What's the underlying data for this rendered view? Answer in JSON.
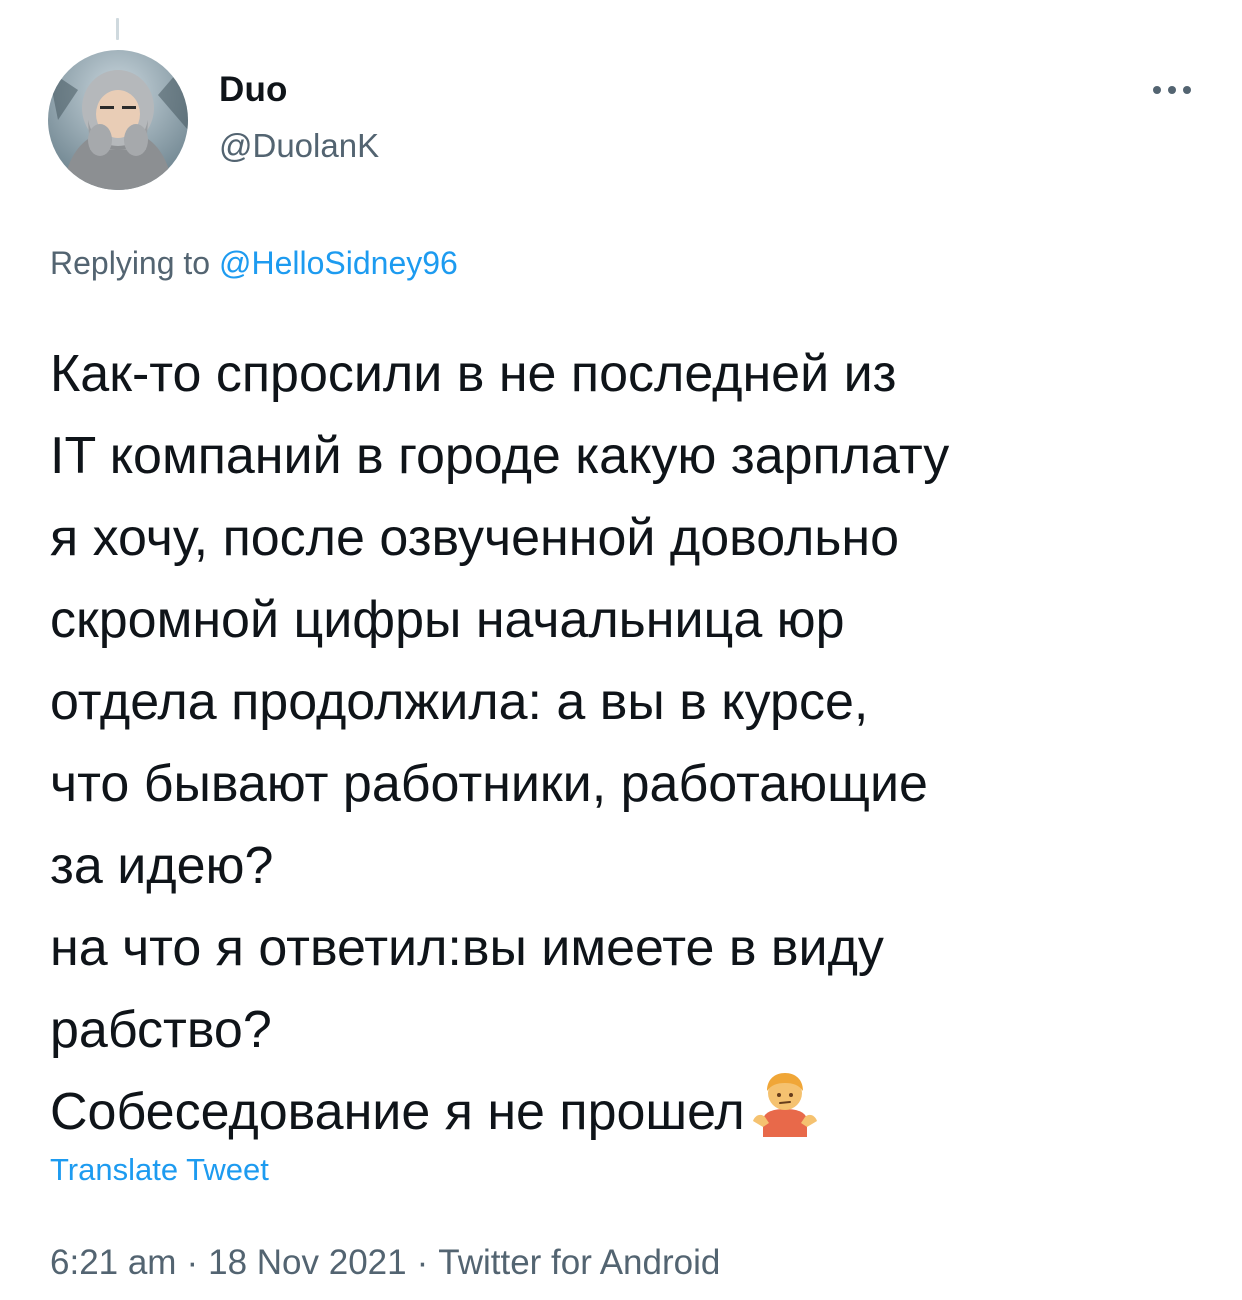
{
  "tweet": {
    "author": {
      "display_name": "Duo",
      "handle": "@DuolanK"
    },
    "more_icon": "more-horizontal-icon",
    "replying": {
      "prefix": "Replying to",
      "mention": "@HelloSidney96"
    },
    "text_lines": [
      "Как-то спросили в не последней из",
      "IT компаний в городе какую зарплату",
      "я хочу, после озвученной довольно",
      "скромной цифры начальница юр",
      "отдела продолжила: а вы в курсе,",
      "что бывают работники, работающие",
      "за идею?",
      "на что я ответил:вы имеете в виду",
      "рабство?",
      "Собеседование я не прошел"
    ],
    "emoji": "person-shrugging-emoji",
    "translate_label": "Translate Tweet",
    "time": "6:21 am",
    "separator": "·",
    "date": "18 Nov 2021",
    "source": "Twitter for Android"
  },
  "colors": {
    "text": "#0f1419",
    "secondary": "#536471",
    "accent": "#1d9bf0"
  }
}
